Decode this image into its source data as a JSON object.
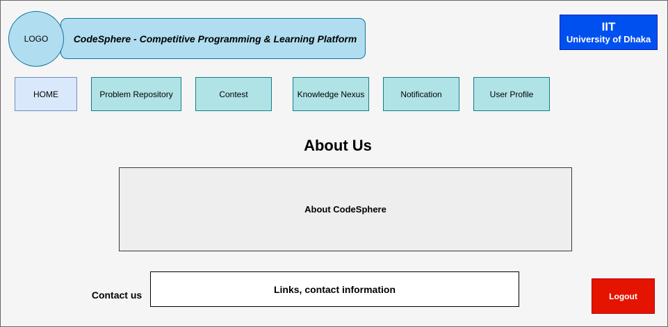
{
  "header": {
    "logo_text": "LOGO",
    "platform_title": "CodeSphere - Competitive Programming & Learning Platform",
    "org_line1": "IIT",
    "org_line2": "University of Dhaka"
  },
  "nav": {
    "items": [
      {
        "label": "HOME",
        "active": true
      },
      {
        "label": "Problem Repository",
        "active": false
      },
      {
        "label": "Contest",
        "active": false
      },
      {
        "label": "Knowledge Nexus",
        "active": false
      },
      {
        "label": "Notification",
        "active": false
      },
      {
        "label": "User Profile",
        "active": false
      }
    ]
  },
  "main": {
    "heading": "About Us",
    "about_placeholder": "About CodeSphere"
  },
  "footer": {
    "contact_label": "Contact us",
    "contact_placeholder": "Links, contact information",
    "logout_label": "Logout"
  },
  "colors": {
    "nav_active": "#dae8fc",
    "nav_default": "#b0e3e6",
    "org_box": "#0050ef",
    "logout": "#e51400",
    "banner": "#b1ddf0"
  }
}
